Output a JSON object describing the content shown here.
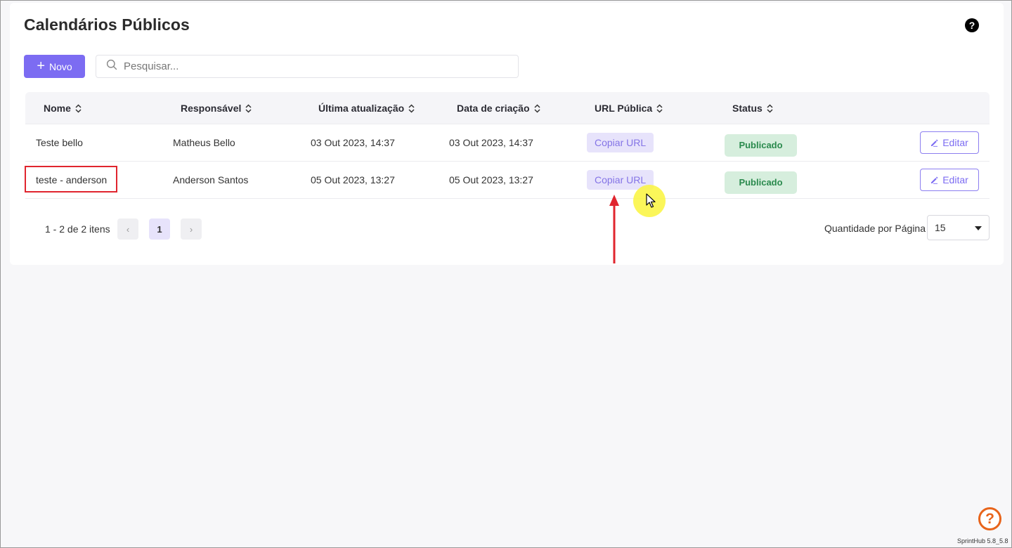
{
  "header": {
    "title": "Calendários Públicos",
    "help_icon": "?"
  },
  "toolbar": {
    "new_label": "Novo",
    "new_icon": "plus-icon",
    "search_placeholder": "Pesquisar...",
    "search_icon": "search-icon"
  },
  "table": {
    "columns": [
      {
        "label": "Nome"
      },
      {
        "label": "Responsável"
      },
      {
        "label": "Última atualização"
      },
      {
        "label": "Data de criação"
      },
      {
        "label": "URL Pública"
      },
      {
        "label": "Status"
      }
    ],
    "rows": [
      {
        "name": "Teste bello",
        "owner": "Matheus Bello",
        "updated": "03 Out 2023, 14:37",
        "created": "03 Out 2023, 14:37",
        "url_button": "Copiar URL",
        "status": "Publicado",
        "edit": "Editar"
      },
      {
        "name": "teste - anderson",
        "owner": "Anderson Santos",
        "updated": "05 Out 2023, 13:27",
        "created": "05 Out 2023, 13:27",
        "url_button": "Copiar URL",
        "status": "Publicado",
        "edit": "Editar"
      }
    ]
  },
  "pagination": {
    "info": "1 - 2 de 2 itens",
    "prev": "‹",
    "current": "1",
    "next": "›",
    "per_page_label": "Quantidade por Página",
    "per_page_value": "15"
  },
  "footer": {
    "help_icon": "?",
    "version": "SprintHub 5.8_5.8"
  },
  "colors": {
    "accent": "#7c6cf2",
    "status_green": "#2a8a4d",
    "highlight_red": "#e0252e",
    "help_orange": "#e8641b"
  }
}
